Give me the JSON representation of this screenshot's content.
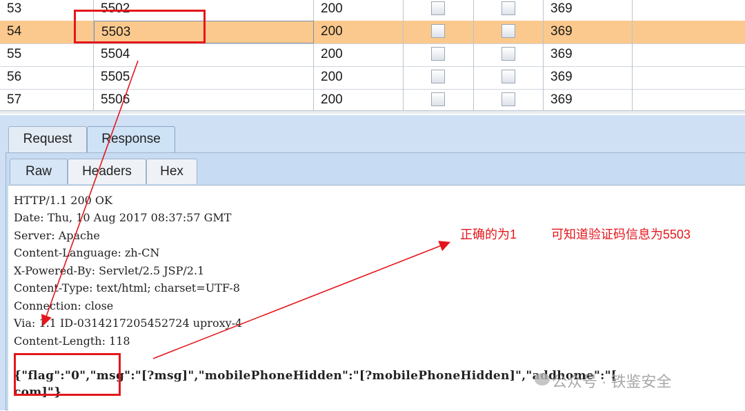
{
  "table": {
    "rows": [
      {
        "num": "53",
        "payload": "5502",
        "status": "200",
        "length": "369",
        "selected": false
      },
      {
        "num": "54",
        "payload": "5503",
        "status": "200",
        "length": "369",
        "selected": true
      },
      {
        "num": "55",
        "payload": "5504",
        "status": "200",
        "length": "369",
        "selected": false
      },
      {
        "num": "56",
        "payload": "5505",
        "status": "200",
        "length": "369",
        "selected": false
      },
      {
        "num": "57",
        "payload": "5506",
        "status": "200",
        "length": "369",
        "selected": false
      }
    ]
  },
  "tabs": {
    "outer": [
      "Request",
      "Response"
    ],
    "outer_active": "Response",
    "inner": [
      "Raw",
      "Headers",
      "Hex"
    ],
    "inner_active": "Raw"
  },
  "response": {
    "lines": [
      "HTTP/1.1 200 OK",
      "Date: Thu, 10 Aug 2017 08:37:57 GMT",
      "Server: Apache",
      "Content-Language: zh-CN",
      "X-Powered-By: Servlet/2.5 JSP/2.1",
      "Content-Type: text/html; charset=UTF-8",
      "Connection: close",
      "Via: 1.1 ID-0314217205452724 uproxy-4",
      "Content-Length: 118"
    ],
    "json_line1": "{\"flag\":\"0\",\"msg\":\"[?msg]\",\"mobilePhoneHidden\":\"[?mobilePhoneHidden]\",\"addhome\":\"[",
    "json_line2": "com]\"}"
  },
  "annotation": {
    "note1": "正确的为1",
    "note2": "可知道验证码信息为5503",
    "color": "#e4161b"
  },
  "watermark": "公众号 · 铁鉴安全"
}
